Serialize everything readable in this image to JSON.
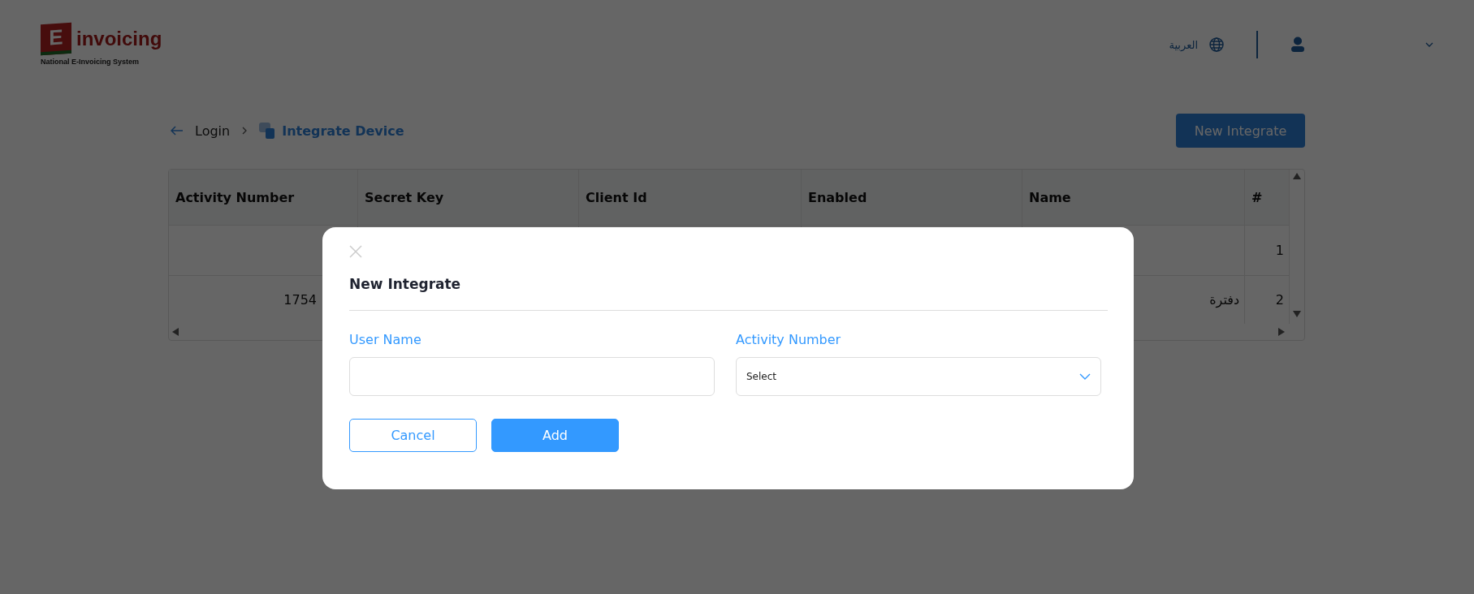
{
  "header": {
    "logo": {
      "letter": "E",
      "word": "invoicing",
      "tagline": "National E-Invoicing System"
    },
    "language": "العربية"
  },
  "breadcrumb": {
    "back": "Login",
    "current": "Integrate Device"
  },
  "new_button": "New Integrate",
  "table": {
    "columns": [
      "Activity Number",
      "Secret Key",
      "Client Id",
      "Enabled",
      "Name",
      "#"
    ],
    "rows": [
      {
        "cells": [
          "",
          "",
          "",
          "",
          "",
          "1"
        ]
      },
      {
        "cells": [
          "1754",
          "",
          "",
          "",
          "دفترة",
          "2"
        ]
      }
    ]
  },
  "modal": {
    "title": "New Integrate",
    "fields": [
      {
        "kind": "text",
        "label": "User Name"
      },
      {
        "kind": "select",
        "label": "Activity Number",
        "value": "Select"
      }
    ],
    "buttons": [
      {
        "label": "Cancel",
        "kind": "secondary"
      },
      {
        "label": "Add",
        "kind": "primary"
      }
    ]
  }
}
